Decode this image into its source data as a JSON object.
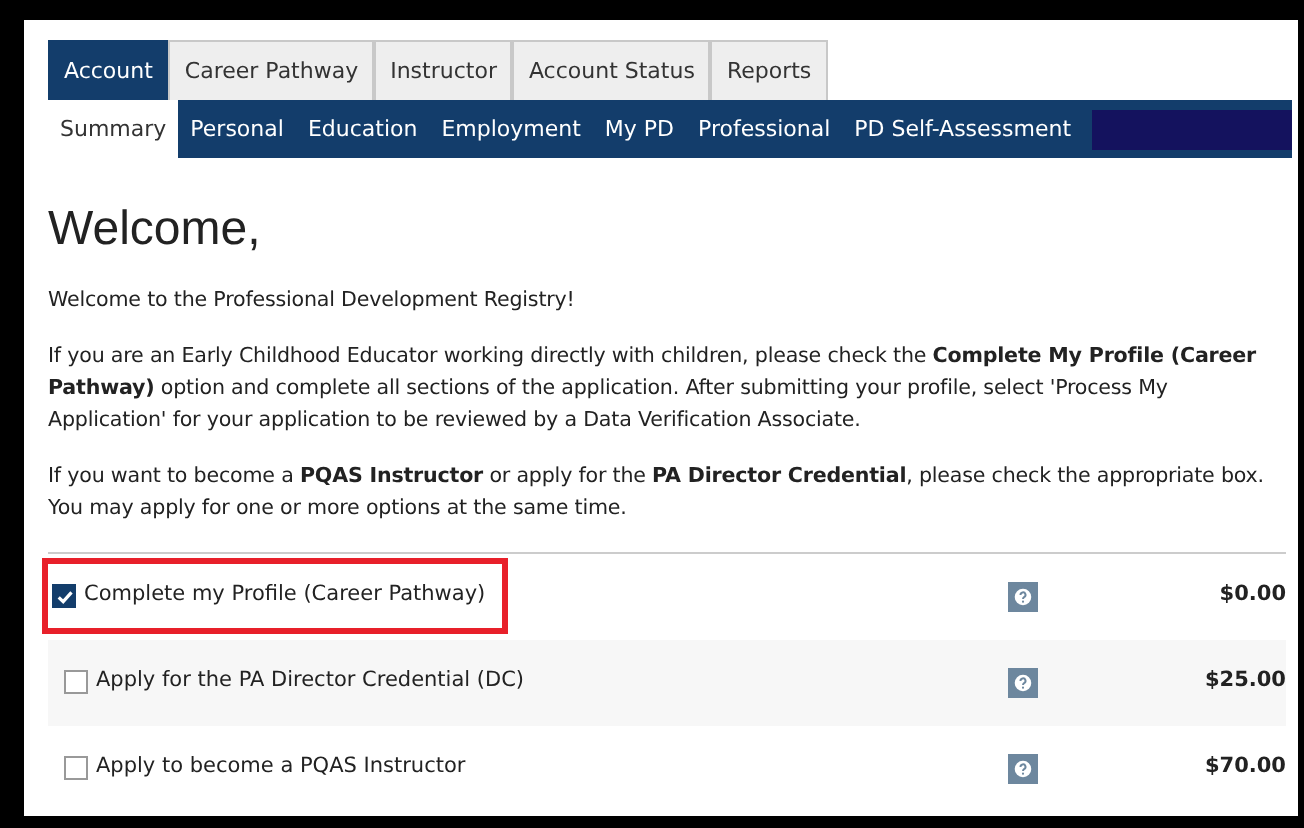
{
  "tabs": [
    {
      "label": "Account",
      "selected": true
    },
    {
      "label": "Career Pathway",
      "selected": false
    },
    {
      "label": "Instructor",
      "selected": false
    },
    {
      "label": "Account Status",
      "selected": false
    },
    {
      "label": "Reports",
      "selected": false
    }
  ],
  "subtabs": [
    {
      "label": "Summary",
      "selected": true
    },
    {
      "label": "Personal",
      "selected": false
    },
    {
      "label": "Education",
      "selected": false
    },
    {
      "label": "Employment",
      "selected": false
    },
    {
      "label": "My PD",
      "selected": false
    },
    {
      "label": "Professional",
      "selected": false
    },
    {
      "label": "PD Self-Assessment",
      "selected": false
    }
  ],
  "heading": "Welcome,",
  "paragraphs": [
    "Welcome to the Professional Development Registry!",
    "If you are an Early Childhood Educator working directly with children, please check the **Complete My Profile (Career Pathway)** option and complete all sections of the application. After submitting your profile, select 'Process My Application' for your application to be reviewed by a Data Verification Associate.",
    "If you want to become a **PQAS Instructor** or apply for the **PA Director Credential**, please check the appropriate box. You may apply for one or more options at the same time."
  ],
  "options": [
    {
      "label": "Complete my Profile (Career Pathway)",
      "checked": true,
      "highlighted": true,
      "price": "$0.00"
    },
    {
      "label": "Apply for the PA Director Credential (DC)",
      "checked": false,
      "highlighted": false,
      "price": "$25.00"
    },
    {
      "label": "Apply to become a PQAS Instructor",
      "checked": false,
      "highlighted": false,
      "price": "$70.00"
    }
  ]
}
